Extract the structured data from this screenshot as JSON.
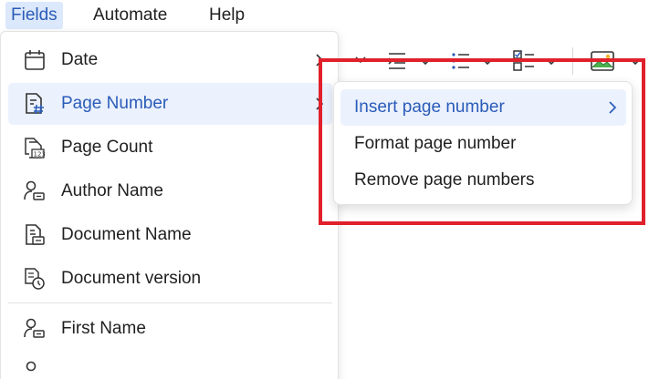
{
  "menubar": {
    "items": [
      {
        "label": "Fields",
        "active": true
      },
      {
        "label": "Automate",
        "active": false
      },
      {
        "label": "Help",
        "active": false
      }
    ]
  },
  "fields_menu": {
    "items": [
      {
        "label": "Date",
        "icon": "calendar-icon",
        "has_submenu": true
      },
      {
        "label": "Page Number",
        "icon": "page-number-icon",
        "has_submenu": true,
        "active": true
      },
      {
        "label": "Page Count",
        "icon": "page-count-icon"
      },
      {
        "label": "Author Name",
        "icon": "author-icon"
      },
      {
        "label": "Document Name",
        "icon": "document-name-icon"
      },
      {
        "label": "Document version",
        "icon": "document-version-icon"
      },
      {
        "label": "First Name",
        "icon": "user-icon"
      }
    ]
  },
  "page_number_submenu": {
    "items": [
      {
        "label": "Insert page number",
        "active": true,
        "has_submenu": true
      },
      {
        "label": "Format page number"
      },
      {
        "label": "Remove page numbers"
      }
    ]
  },
  "colors": {
    "accent": "#2a5cb8",
    "active_background": "#ebf1fd",
    "highlight_frame": "#e0202b"
  }
}
